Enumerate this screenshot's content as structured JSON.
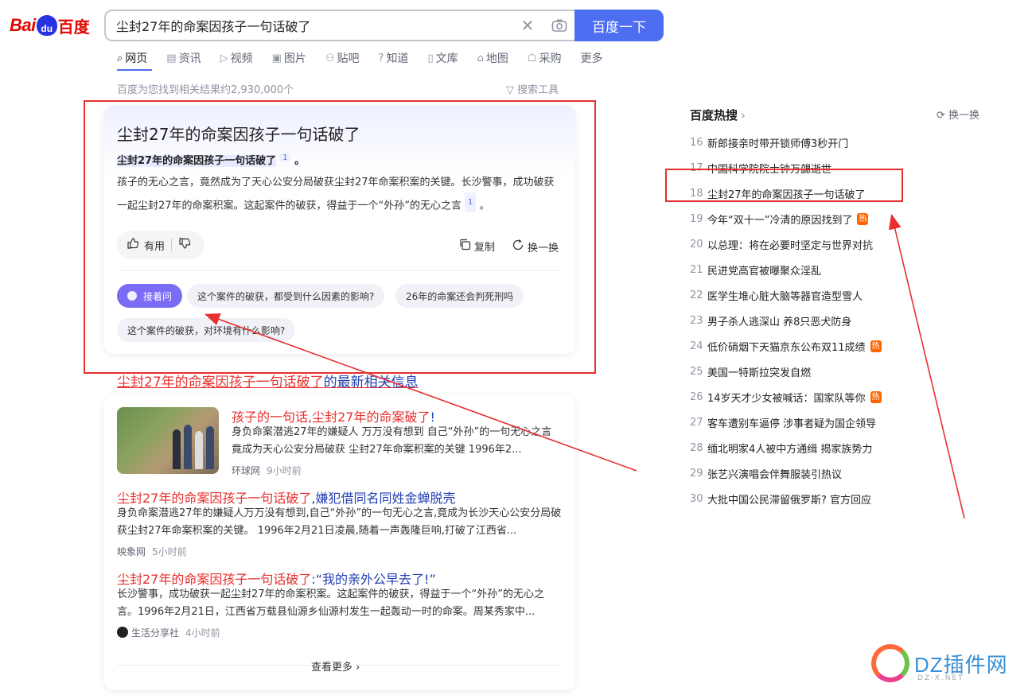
{
  "logo": {
    "bai": "Bai",
    "du": "du",
    "cn": "百度"
  },
  "search": {
    "query": "尘封27年的命案因孩子一句话破了",
    "clear_icon": "✕",
    "camera_icon": "camera-icon",
    "button_label": "百度一下"
  },
  "tabs": [
    {
      "icon": "⌕",
      "label": "网页"
    },
    {
      "icon": "▤",
      "label": "资讯"
    },
    {
      "icon": "▷",
      "label": "视频"
    },
    {
      "icon": "▣",
      "label": "图片"
    },
    {
      "icon": "⚇",
      "label": "贴吧"
    },
    {
      "icon": "?",
      "label": "知道"
    },
    {
      "icon": "▯",
      "label": "文库"
    },
    {
      "icon": "⌂",
      "label": "地图"
    },
    {
      "icon": "☖",
      "label": "采购"
    },
    {
      "icon": "",
      "label": "更多"
    }
  ],
  "results_info": {
    "count_text": "百度为您找到相关结果约2,930,000个",
    "tools_label": "搜索工具"
  },
  "ai_answer": {
    "title": "尘封27年的命案因孩子一句话破了",
    "bold_text": "尘封27年的命案因孩子一句话破了",
    "cite_1": "1",
    "period": "。",
    "paragraph": "孩子的无心之言，竟然成为了天心公安分局破获尘封27年命案积案的关键。长沙警事，成功破获一起尘封27年的命案积案。这起案件的破获，得益于一个“外孙”的无心之言",
    "cite_2": "1",
    "helpful_label": "有用",
    "copy_label": "复制",
    "refresh_label": "换一换",
    "followup_label": "接着问",
    "suggestions": [
      "这个案件的破获，都受到什么因素的影响?",
      "26年的命案还会判死刑吗",
      "这个案件的破获，对环境有什么影响?"
    ]
  },
  "news": {
    "header_red": "尘封27年的命案因孩子一句话破了",
    "header_blue": "的最新相关信息",
    "items": [
      {
        "title_red": "孩子的一句话,尘封27年的命案破了",
        "title_blue": "!",
        "snippet": "身负命案潜逃27年的嫌疑人 万万没有想到 自己“外孙”的一句无心之言 竟成为天心公安分局破获 尘封27年命案积案的关键 1996年2...",
        "source": "环球网",
        "time": "9小时前"
      },
      {
        "title_red": "尘封27年的命案因孩子一句话破了",
        "title_blue": ",嫌犯借同名同姓金蝉脱壳",
        "snippet": "身负命案潜逃27年的嫌疑人万万没有想到,自己“外孙”的一句无心之言,竟成为长沙天心公安分局破获尘封27年命案积案的关键。 1996年2月21日凌晨,随着一声轰隆巨响,打破了江西省...",
        "source": "映象网",
        "time": "5小时前"
      },
      {
        "title_red": "尘封27年的命案因孩子一句话破了",
        "title_blue": ":“我的亲外公早去了!”",
        "snippet": "长沙警事，成功破获一起尘封27年的命案积案。这起案件的破获，得益于一个“外孙”的无心之言。1996年2月21日，江西省万载县仙源乡仙源村发生一起轰动一时的命案。周某秀家中...",
        "source": "生活分享社",
        "time": "4小时前"
      }
    ],
    "more_label": "查看更多 ›"
  },
  "hot": {
    "title": "百度热搜",
    "chevron": "›",
    "refresh_label": "换一换",
    "items": [
      {
        "n": "16",
        "text": "新郎接亲时带开锁师傅3秒开门",
        "badge": ""
      },
      {
        "n": "17",
        "text": "中国科学院院士钟万勰逝世",
        "badge": ""
      },
      {
        "n": "18",
        "text": "尘封27年的命案因孩子一句话破了",
        "badge": ""
      },
      {
        "n": "19",
        "text": "今年“双十一”冷清的原因找到了",
        "badge": "热"
      },
      {
        "n": "20",
        "text": "以总理：将在必要时坚定与世界对抗",
        "badge": ""
      },
      {
        "n": "21",
        "text": "民进党高官被曝聚众淫乱",
        "badge": ""
      },
      {
        "n": "22",
        "text": "医学生堆心脏大脑等器官造型雪人",
        "badge": ""
      },
      {
        "n": "23",
        "text": "男子杀人逃深山 养8只恶犬防身",
        "badge": ""
      },
      {
        "n": "24",
        "text": "低价硝烟下天猫京东公布双11成绩",
        "badge": "热"
      },
      {
        "n": "25",
        "text": "美国一特斯拉突发自燃",
        "badge": ""
      },
      {
        "n": "26",
        "text": "14岁天才少女被喊话：国家队等你",
        "badge": "热"
      },
      {
        "n": "27",
        "text": "客车遭别车逼停 涉事者疑为国企领导",
        "badge": ""
      },
      {
        "n": "28",
        "text": "缅北明家4人被中方通缉 揭家族势力",
        "badge": ""
      },
      {
        "n": "29",
        "text": "张艺兴演唱会伴舞服装引热议",
        "badge": ""
      },
      {
        "n": "30",
        "text": "大批中国公民滞留俄罗斯? 官方回应",
        "badge": ""
      }
    ]
  },
  "watermark": {
    "text": "DZ插件网",
    "sub": "DZ-X.NET"
  },
  "colors": {
    "brand_blue": "#4e6ef2",
    "link_blue": "#2440b3",
    "highlight_red": "#e8302e",
    "annotation_red": "#e8302e",
    "hot_badge": "#ff6600"
  }
}
